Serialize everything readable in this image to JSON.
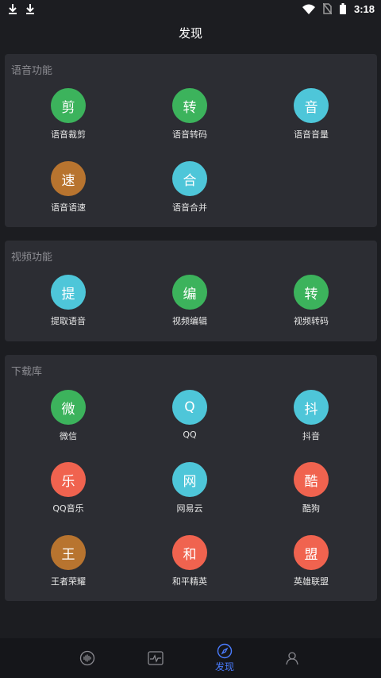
{
  "status_bar": {
    "time": "3:18"
  },
  "header": {
    "title": "发现"
  },
  "sections": [
    {
      "title": "语音功能",
      "items": [
        {
          "glyph": "剪",
          "label": "语音裁剪",
          "color": "#3cb35c"
        },
        {
          "glyph": "转",
          "label": "语音转码",
          "color": "#3cb35c"
        },
        {
          "glyph": "音",
          "label": "语音音量",
          "color": "#4ec6d9"
        },
        {
          "glyph": "速",
          "label": "语音语速",
          "color": "#b8742f"
        },
        {
          "glyph": "合",
          "label": "语音合并",
          "color": "#4ec6d9"
        }
      ]
    },
    {
      "title": "视频功能",
      "items": [
        {
          "glyph": "提",
          "label": "提取语音",
          "color": "#4ec6d9"
        },
        {
          "glyph": "编",
          "label": "视频编辑",
          "color": "#3cb35c"
        },
        {
          "glyph": "转",
          "label": "视频转码",
          "color": "#3cb35c"
        }
      ]
    },
    {
      "title": "下载库",
      "items": [
        {
          "glyph": "微",
          "label": "微信",
          "color": "#3cb35c"
        },
        {
          "glyph": "Q",
          "label": "QQ",
          "color": "#4ec6d9"
        },
        {
          "glyph": "抖",
          "label": "抖音",
          "color": "#4ec6d9"
        },
        {
          "glyph": "乐",
          "label": "QQ音乐",
          "color": "#f0634f"
        },
        {
          "glyph": "网",
          "label": "网易云",
          "color": "#4ec6d9"
        },
        {
          "glyph": "酷",
          "label": "酷狗",
          "color": "#f0634f"
        },
        {
          "glyph": "王",
          "label": "王者荣耀",
          "color": "#b8742f"
        },
        {
          "glyph": "和",
          "label": "和平精英",
          "color": "#f0634f"
        },
        {
          "glyph": "盟",
          "label": "英雄联盟",
          "color": "#f0634f"
        }
      ]
    }
  ],
  "bottom_nav": {
    "active_index": 2,
    "active_color": "#4a7cff",
    "tabs": [
      {
        "icon": "audio-wave-icon",
        "label": ""
      },
      {
        "icon": "pulse-monitor-icon",
        "label": ""
      },
      {
        "icon": "compass-icon",
        "label": "发现"
      },
      {
        "icon": "user-icon",
        "label": ""
      }
    ]
  }
}
